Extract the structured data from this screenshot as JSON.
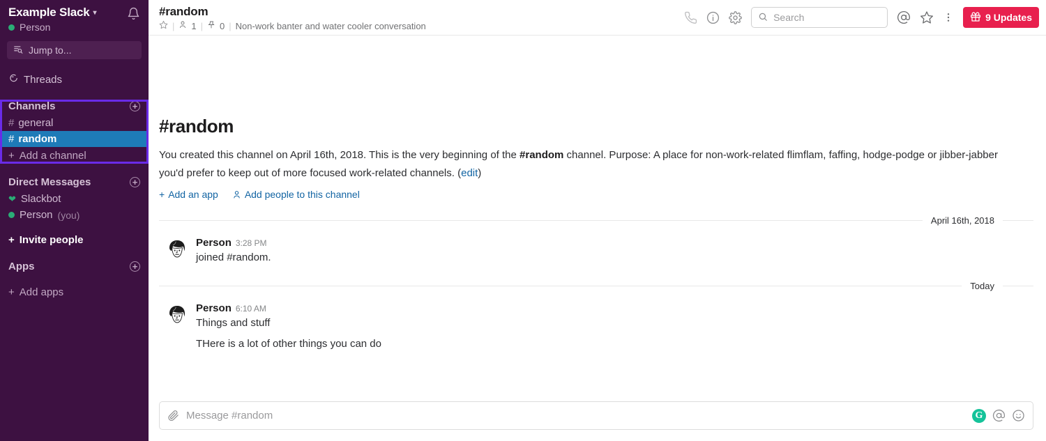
{
  "sidebar": {
    "team_name": "Example Slack",
    "caret_icon": "chevron-down-icon",
    "bell_icon": "bell-icon",
    "user_name": "Person",
    "jump_to": {
      "label": "Jump to...",
      "icon": "jump-to-icon"
    },
    "threads": {
      "label": "Threads",
      "icon": "threads-icon"
    },
    "channels_section": {
      "title": "Channels",
      "add_icon": "plus-circle-icon",
      "items": [
        {
          "prefix": "#",
          "name": "general",
          "active": false
        },
        {
          "prefix": "#",
          "name": "random",
          "active": true
        }
      ],
      "add_channel_label": "Add a channel"
    },
    "dm_section": {
      "title": "Direct Messages",
      "add_icon": "plus-circle-icon",
      "items": [
        {
          "name": "Slackbot",
          "suffix": "",
          "status": "heart"
        },
        {
          "name": "Person",
          "suffix": "(you)",
          "status": "online"
        }
      ]
    },
    "invite_people_label": "Invite people",
    "apps_section": {
      "title": "Apps",
      "add_icon": "plus-circle-icon",
      "add_apps_label": "Add apps"
    },
    "highlight_color": "#6A2BE8",
    "background_color": "#3D1141",
    "active_color": "#1E7BB8"
  },
  "header": {
    "channel_title": "#random",
    "star_icon": "star-outline-icon",
    "members_icon": "person-icon",
    "members_count": "1",
    "pin_icon": "pin-icon",
    "pin_count": "0",
    "description": "Non-work banter and water cooler conversation",
    "call_icon": "phone-icon",
    "info_icon": "info-circle-icon",
    "settings_icon": "gear-icon",
    "search": {
      "icon": "search-icon",
      "placeholder": "Search",
      "value": ""
    },
    "mention_icon": "at-mention-icon",
    "star_right_icon": "star-outline-icon",
    "more_icon": "more-vertical-icon",
    "updates_button": {
      "label": "9 Updates",
      "icon": "gift-icon",
      "color": "#E8204E"
    }
  },
  "intro": {
    "title": "#random",
    "text_part1": "You created this channel on April 16th, 2018. This is the very beginning of the ",
    "channel_bold": "#random",
    "text_part2": " channel. Purpose: A place for non-work-related flimflam, faffing, hodge-podge or jibber-jabber you'd prefer to keep out of more focused work-related channels. (",
    "edit_link": "edit",
    "text_part3": ")",
    "add_app_label": "Add an app",
    "add_app_icon": "plus-icon",
    "add_people_label": "Add people to this channel",
    "add_people_icon": "person-add-icon"
  },
  "messages": {
    "dividers": [
      {
        "label": "April 16th, 2018"
      },
      {
        "label": "Today"
      }
    ],
    "items": [
      {
        "author": "Person",
        "time": "3:28 PM",
        "avatar_icon": "user-avatar-face",
        "lines": [
          "joined #random."
        ]
      },
      {
        "author": "Person",
        "time": "6:10 AM",
        "avatar_icon": "user-avatar-face",
        "lines": [
          "Things and stuff",
          "THere is a lot of other things you can do"
        ]
      }
    ]
  },
  "composer": {
    "attach_icon": "paperclip-icon",
    "placeholder": "Message #random",
    "value": "",
    "grammarly_icon": "grammarly-g-icon",
    "grammarly_letter": "G",
    "mention_icon": "at-mention-icon",
    "emoji_icon": "smiley-icon"
  }
}
